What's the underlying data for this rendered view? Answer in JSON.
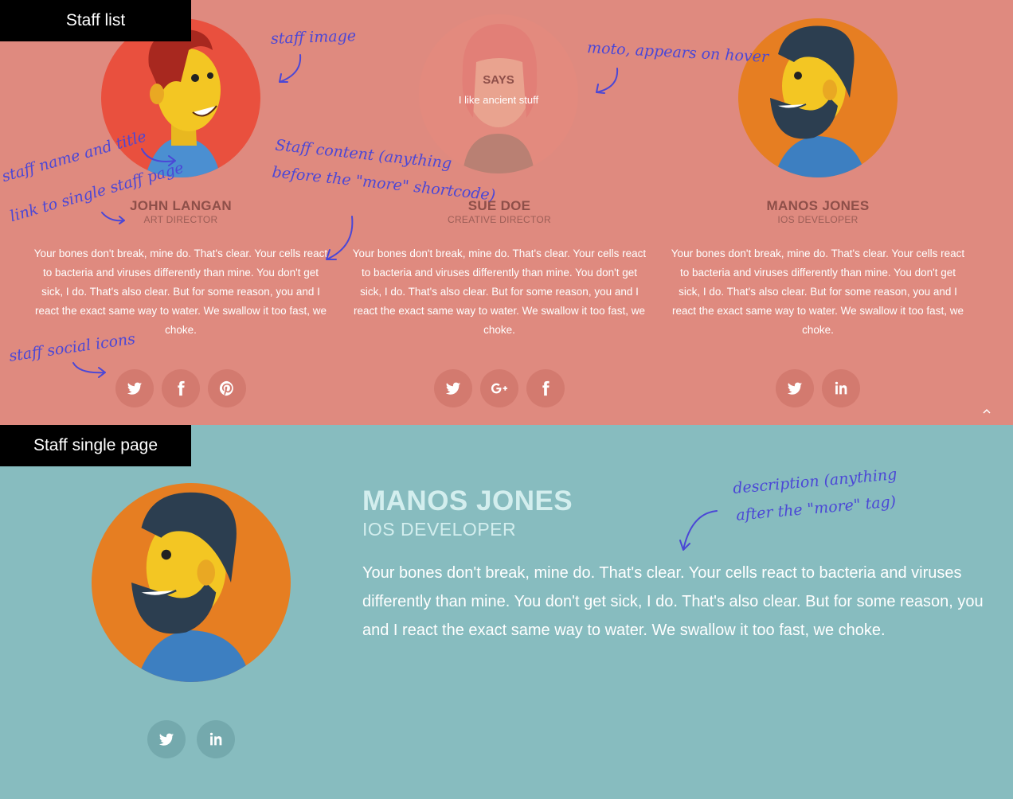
{
  "sections": {
    "list_tag": "Staff list",
    "single_tag": "Staff single page"
  },
  "staff": [
    {
      "name": "JOHN LANGAN",
      "title": "ART DIRECTOR",
      "description": "Your bones don't break, mine do. That's clear. Your cells react to bacteria and viruses differently than mine. You don't get sick, I do. That's also clear. But for some reason, you and I react the exact same way to water. We swallow it too fast, we choke.",
      "socials": [
        "twitter-icon",
        "facebook-icon",
        "pinterest-icon"
      ]
    },
    {
      "name": "SUE DOE",
      "title": "CREATIVE DIRECTOR",
      "description": "Your bones don't break, mine do. That's clear. Your cells react to bacteria and viruses differently than mine. You don't get sick, I do. That's also clear. But for some reason, you and I react the exact same way to water. We swallow it too fast, we choke.",
      "socials": [
        "twitter-icon",
        "google-plus-icon",
        "facebook-icon"
      ],
      "hover": {
        "says": "SAYS",
        "moto": "I like ancient stuff"
      }
    },
    {
      "name": "MANOS JONES",
      "title": "IOS DEVELOPER",
      "description": "Your bones don't break, mine do. That's clear. Your cells react to bacteria and viruses differently than mine. You don't get sick, I do. That's also clear. But for some reason, you and I react the exact same way to water. We swallow it too fast, we choke.",
      "socials": [
        "twitter-icon",
        "linkedin-icon"
      ]
    }
  ],
  "annotations": {
    "staff_image": "staff image",
    "moto": "moto, appears on hover",
    "name_title": "staff name and title",
    "link_single": "link to single staff page",
    "content_1": "Staff content (anything",
    "content_2": "before the \"more\" shortcode)",
    "social_icons": "staff social icons",
    "description_1": "description (anything",
    "description_2": "after the \"more\" tag)"
  },
  "single": {
    "name": "MANOS JONES",
    "title": "IOS DEVELOPER",
    "description": "Your bones don't break, mine do. That's clear. Your cells react to bacteria and viruses differently than mine. You don't get sick, I do. That's also clear. But for some reason, you and I react the exact same way to water. We swallow it too fast, we choke.",
    "socials": [
      "twitter-icon",
      "linkedin-icon"
    ]
  },
  "scroll_top_icon": "chevron-up-icon",
  "colors": {
    "top_bg": "#df8a7f",
    "bottom_bg": "#87bcbf",
    "annotation": "#4b47d6"
  }
}
